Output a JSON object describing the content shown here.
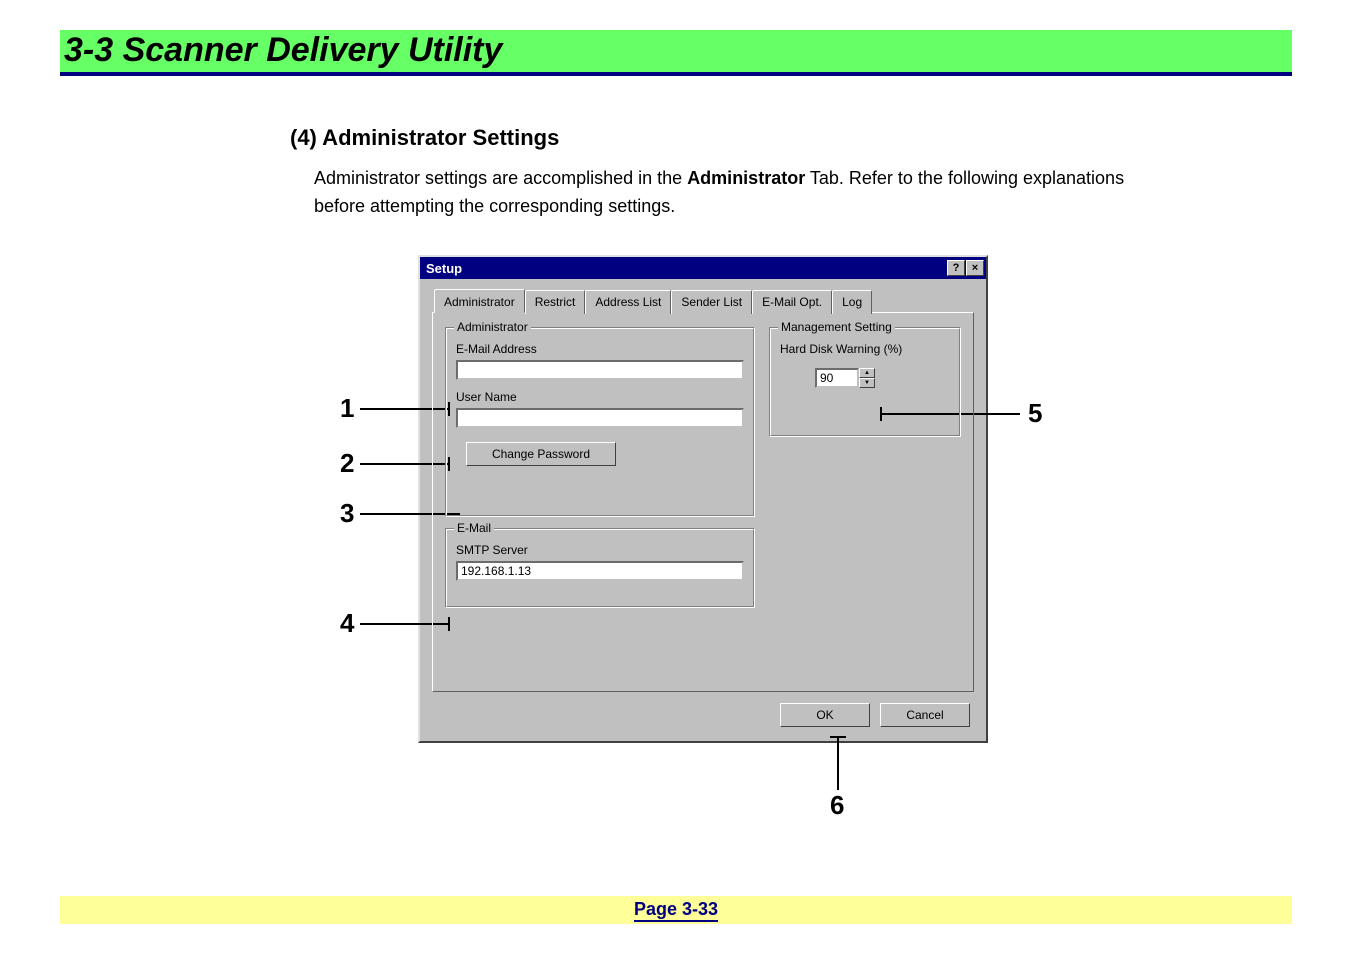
{
  "header": {
    "title": "3-3  Scanner Delivery Utility"
  },
  "section": {
    "heading": "(4) Administrator Settings",
    "intro_pre": "Administrator settings are accomplished in the ",
    "intro_bold": "Administrator",
    "intro_post": " Tab. Refer to the following explanations before attempting the corresponding settings."
  },
  "dialog": {
    "title": "Setup",
    "help_icon": "?",
    "close_icon": "×",
    "tabs": [
      "Administrator",
      "Restrict",
      "Address List",
      "Sender List",
      "E-Mail Opt.",
      "Log"
    ],
    "active_tab": "Administrator",
    "admin_group": {
      "legend": "Administrator",
      "email_label": "E-Mail Address",
      "email_value": "",
      "username_label": "User Name",
      "username_value": "",
      "change_pw_label": "Change Password"
    },
    "mgmt_group": {
      "legend": "Management Setting",
      "hd_label": "Hard Disk Warning (%)",
      "hd_value": "90"
    },
    "email_group": {
      "legend": "E-Mail",
      "smtp_label": "SMTP Server",
      "smtp_value": "192.168.1.13"
    },
    "ok_label": "OK",
    "cancel_label": "Cancel"
  },
  "callouts": {
    "c1": "1",
    "c2": "2",
    "c3": "3",
    "c4": "4",
    "c5": "5",
    "c6": "6"
  },
  "footer": {
    "page": "Page 3-33"
  }
}
